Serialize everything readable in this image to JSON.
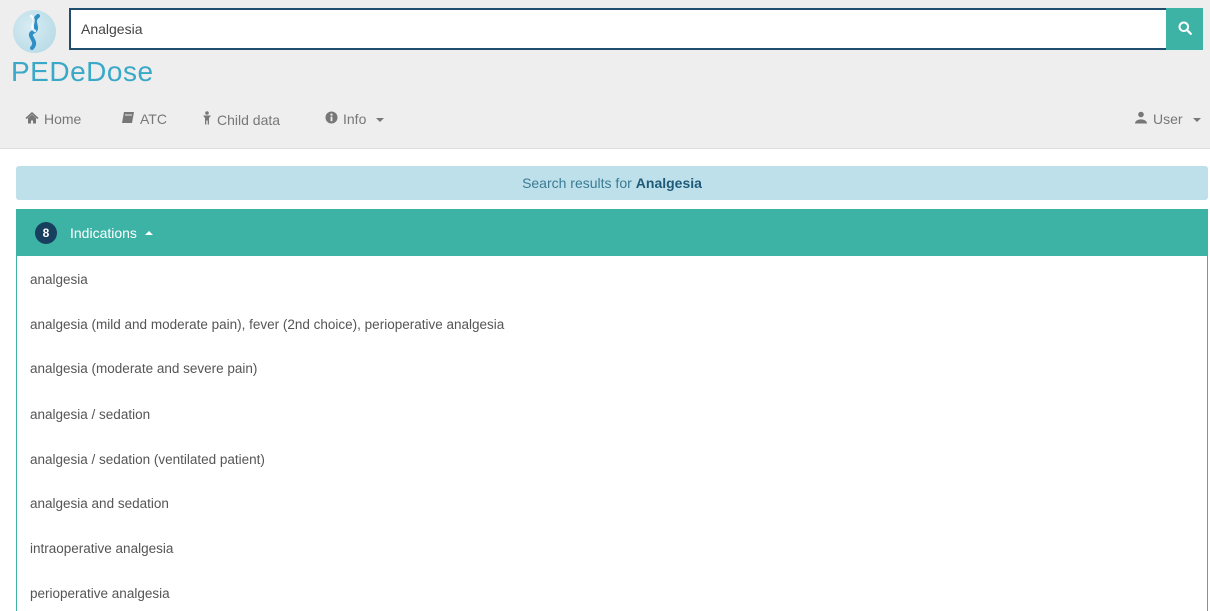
{
  "search": {
    "value": "Analgesia",
    "button_icon": "search-icon"
  },
  "brand": {
    "name": "PEDeDose",
    "logo_icon": "pededose-logo-icon"
  },
  "nav": {
    "items": [
      {
        "label": "Home",
        "icon": "home-icon"
      },
      {
        "label": "ATC",
        "icon": "book-icon"
      },
      {
        "label": "Child data",
        "icon": "child-icon"
      },
      {
        "label": "Info",
        "icon": "info-circle-icon"
      }
    ],
    "user_label": "User",
    "user_icon": "user-icon"
  },
  "results": {
    "prefix": "Search results for",
    "query": "Analgesia"
  },
  "panel": {
    "count": "8",
    "title": "Indications",
    "items": [
      "analgesia",
      "analgesia (mild and moderate pain), fever (2nd choice), perioperative analgesia",
      "analgesia (moderate and severe pain)",
      "analgesia / sedation",
      "analgesia / sedation (ventilated patient)",
      "analgesia and sedation",
      "intraoperative analgesia",
      "perioperative analgesia"
    ]
  },
  "colors": {
    "accent": "#3db3a6",
    "brand": "#3aa8c7",
    "banner": "#bde0ea",
    "badge": "#173f5e",
    "search_border": "#1f4e6e"
  }
}
